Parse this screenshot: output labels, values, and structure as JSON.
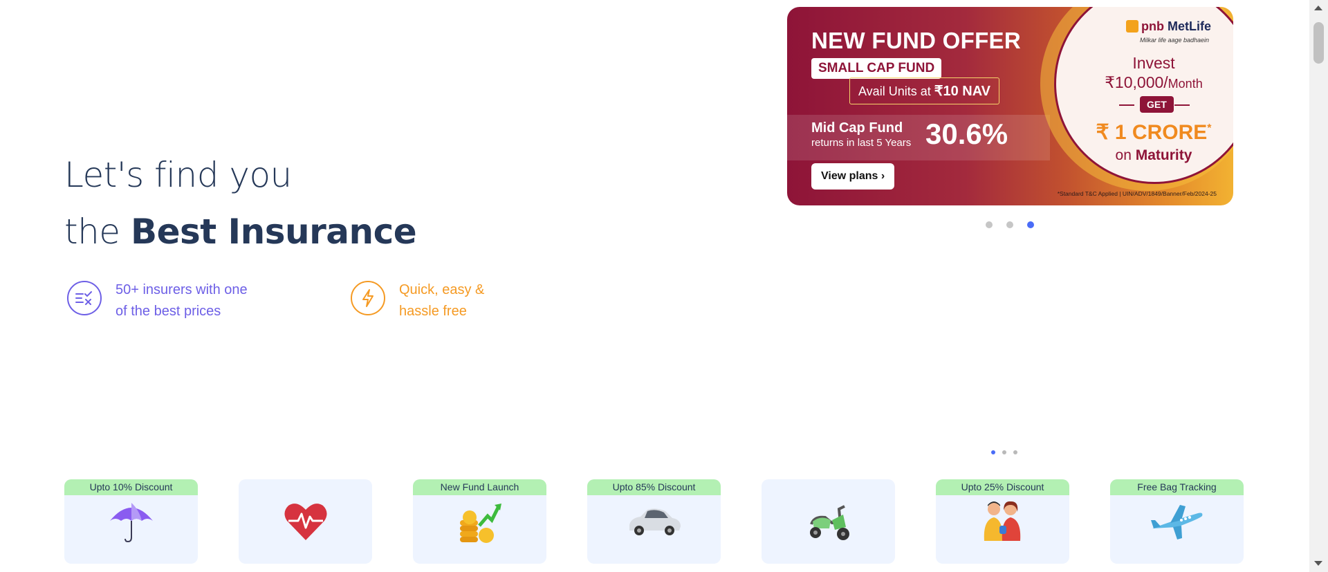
{
  "hero": {
    "line1": "Let's find you",
    "line2_prefix": "the ",
    "line2_bold": "Best Insurance"
  },
  "features": [
    {
      "icon": "compare-icon",
      "text1": "50+ insurers with one",
      "text2": "of the best prices",
      "color": "#6d5fe6"
    },
    {
      "icon": "lightning-icon",
      "text1": "Quick, easy &",
      "text2": "hassle free",
      "color": "#f59a23"
    }
  ],
  "banner": {
    "headline": "NEW FUND OFFER",
    "fund_tag": "SMALL CAP FUND",
    "avail_prefix": "Avail Units at ",
    "avail_value": "₹10 NAV",
    "mid_name": "Mid Cap Fund",
    "mid_sub": "returns in last 5 Years",
    "mid_pct": "30.6%",
    "cta": "View plans",
    "cta_chevron": "›",
    "brand_pnb": "pnb",
    "brand_name": "MetLife",
    "tagline": "Milkar life aage badhaein",
    "invest": "Invest",
    "amount": "₹10,000/",
    "amount_unit": "Month",
    "get": "GET",
    "crore": "₹ 1 CRORE",
    "crore_mark": "*",
    "maturity_prefix": "on ",
    "maturity_bold": "Maturity",
    "disclaimer": "*Standard T&C Applied | UIN/ADV/1849/Banner/Feb/2024-25",
    "colors": {
      "maroon": "#8e1438",
      "orange": "#f08a1f"
    }
  },
  "carousel": {
    "slides": 3,
    "active": 3
  },
  "product_carousel": {
    "pages": 3,
    "active": 1
  },
  "products": [
    {
      "tag": "Upto 10% Discount",
      "icon": "umbrella-icon"
    },
    {
      "tag": "",
      "icon": "heart-pulse-icon"
    },
    {
      "tag": "New Fund Launch",
      "icon": "coins-growth-icon"
    },
    {
      "tag": "Upto 85% Discount",
      "icon": "car-icon"
    },
    {
      "tag": "",
      "icon": "scooter-icon"
    },
    {
      "tag": "Upto 25% Discount",
      "icon": "family-icon"
    },
    {
      "tag": "Free Bag Tracking",
      "icon": "airplane-icon"
    }
  ]
}
